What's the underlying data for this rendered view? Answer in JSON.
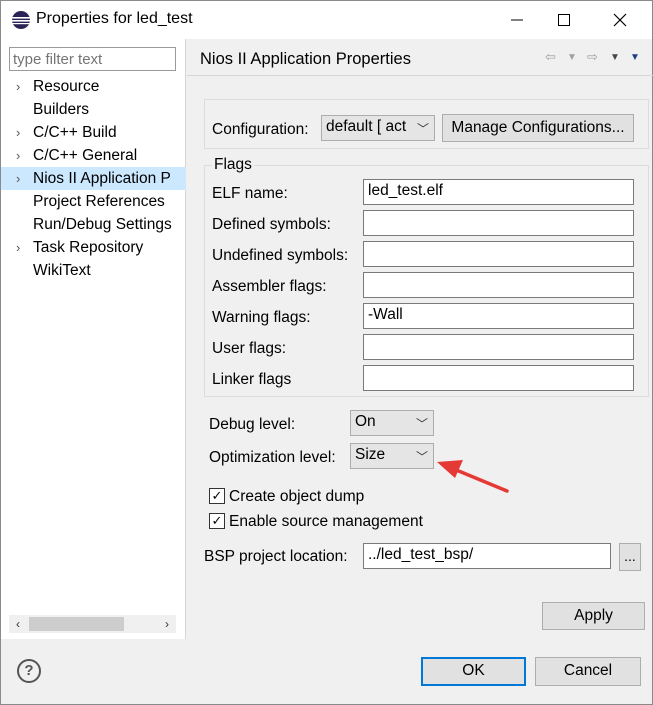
{
  "window": {
    "title": "Properties for led_test",
    "minimize": "—",
    "maximize": "☐",
    "close": "✕"
  },
  "left": {
    "filter_placeholder": "type filter text",
    "tree": [
      {
        "label": "Resource",
        "expandable": true
      },
      {
        "label": "Builders",
        "expandable": false
      },
      {
        "label": "C/C++ Build",
        "expandable": true
      },
      {
        "label": "C/C++ General",
        "expandable": true
      },
      {
        "label": "Nios II Application P",
        "expandable": true,
        "selected": true
      },
      {
        "label": "Project References",
        "expandable": false
      },
      {
        "label": "Run/Debug Settings",
        "expandable": false
      },
      {
        "label": "Task Repository",
        "expandable": true
      },
      {
        "label": "WikiText",
        "expandable": false
      }
    ]
  },
  "page": {
    "title": "Nios II Application Properties",
    "configuration_label": "Configuration:",
    "configuration_value": "default  [ act",
    "manage_button": "Manage Configurations...",
    "flags_title": "Flags",
    "flags": [
      {
        "label": "ELF name:",
        "value": "led_test.elf"
      },
      {
        "label": "Defined symbols:",
        "value": ""
      },
      {
        "label": "Undefined symbols:",
        "value": ""
      },
      {
        "label": "Assembler flags:",
        "value": ""
      },
      {
        "label": "Warning flags:",
        "value": "-Wall"
      },
      {
        "label": "User flags:",
        "value": ""
      },
      {
        "label": "Linker flags",
        "value": ""
      }
    ],
    "debug_level_label": "Debug level:",
    "debug_level_value": "On",
    "opt_level_label": "Optimization level:",
    "opt_level_value": "Size",
    "create_dump_label": "Create object dump",
    "create_dump_checked": true,
    "source_mgmt_label": "Enable source management",
    "source_mgmt_checked": true,
    "bsp_label": "BSP project location:",
    "bsp_value": "../led_test_bsp/",
    "browse_button": "...",
    "apply_button": "Apply"
  },
  "footer": {
    "help": "?",
    "ok_button": "OK",
    "cancel_button": "Cancel"
  },
  "colors": {
    "selection": "#cce8ff",
    "annotation_arrow": "#e53935",
    "default_button_border": "#0078d7"
  }
}
